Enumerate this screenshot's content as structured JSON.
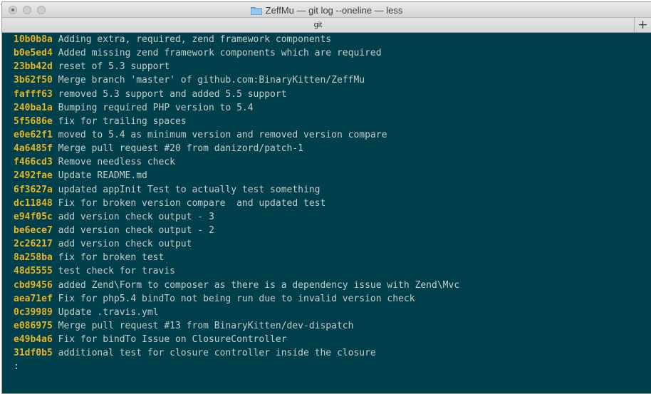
{
  "window": {
    "title": "ZeffMu — git log --oneline — less",
    "tab_label": "git",
    "new_tab_label": "+"
  },
  "colors": {
    "terminal_background": "#003f4c",
    "commit_hash": "#e6b422",
    "commit_message": "#c5ccc8"
  },
  "commits": [
    {
      "hash": "10b0b8a",
      "message": "Adding extra, required, zend framework components"
    },
    {
      "hash": "b0e5ed4",
      "message": "Added missing zend framework components which are required"
    },
    {
      "hash": "23bb42d",
      "message": "reset of 5.3 support"
    },
    {
      "hash": "3b62f50",
      "message": "Merge branch 'master' of github.com:BinaryKitten/ZeffMu"
    },
    {
      "hash": "fafff63",
      "message": "removed 5.3 support and added 5.5 support"
    },
    {
      "hash": "240ba1a",
      "message": "Bumping required PHP version to 5.4"
    },
    {
      "hash": "5f5686e",
      "message": "fix for trailing spaces"
    },
    {
      "hash": "e0e62f1",
      "message": "moved to 5.4 as minimum version and removed version compare"
    },
    {
      "hash": "4a6485f",
      "message": "Merge pull request #20 from danizord/patch-1"
    },
    {
      "hash": "f466cd3",
      "message": "Remove needless check"
    },
    {
      "hash": "2492fae",
      "message": "Update README.md"
    },
    {
      "hash": "6f3627a",
      "message": "updated appInit Test to actually test something"
    },
    {
      "hash": "dc11848",
      "message": "Fix for broken version compare  and updated test"
    },
    {
      "hash": "e94f05c",
      "message": "add version check output - 3"
    },
    {
      "hash": "be6ece7",
      "message": "add version check output - 2"
    },
    {
      "hash": "2c26217",
      "message": "add version check output"
    },
    {
      "hash": "8a258ba",
      "message": "fix for broken test"
    },
    {
      "hash": "48d5555",
      "message": "test check for travis"
    },
    {
      "hash": "cbd9456",
      "message": "added Zend\\Form to composer as there is a dependency issue with Zend\\Mvc"
    },
    {
      "hash": "aea71ef",
      "message": "Fix for php5.4 bindTo not being run due to invalid version check"
    },
    {
      "hash": "0c39989",
      "message": "Update .travis.yml"
    },
    {
      "hash": "e086975",
      "message": "Merge pull request #13 from BinaryKitten/dev-dispatch"
    },
    {
      "hash": "e49b4a6",
      "message": "Fix for bindTo Issue on ClosureController"
    },
    {
      "hash": "31df0b5",
      "message": "additional test for closure controller inside the closure"
    }
  ],
  "prompt": ":"
}
